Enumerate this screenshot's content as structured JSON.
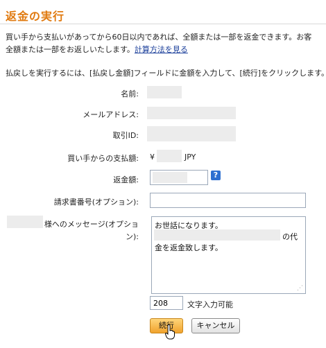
{
  "page": {
    "title": "返金の実行",
    "intro_line1": "買い手から支払いがあってから60日以内であれば、全額または一部を返金できます。お客",
    "intro_line2_text": "全額または一部をお返しいたします。",
    "intro_link": "計算方法を見る",
    "instruction": "払戻しを実行するには、[払戻し金額]フィールドに金額を入力して、[続行]をクリックします。"
  },
  "form": {
    "name_label": "名前:",
    "email_label": "メールアドレス:",
    "txn_label": "取引ID:",
    "paid_label": "買い手からの支払額:",
    "currency_symbol": "¥",
    "currency_code": "JPY",
    "refund_label": "返金額:",
    "refund_value": "",
    "help_icon": "?",
    "invoice_label": "請求書番号(オプション):",
    "invoice_value": "",
    "message_label_1": "様へのメッセージ(オプショ",
    "message_label_2": "ン):",
    "message_line1": "お世話になります。",
    "message_line2_suffix": "の代",
    "message_line3": "金を返金致します。",
    "char_count": "208",
    "char_count_label": "文字入力可能"
  },
  "buttons": {
    "continue": "続行",
    "cancel": "キャンセル"
  }
}
